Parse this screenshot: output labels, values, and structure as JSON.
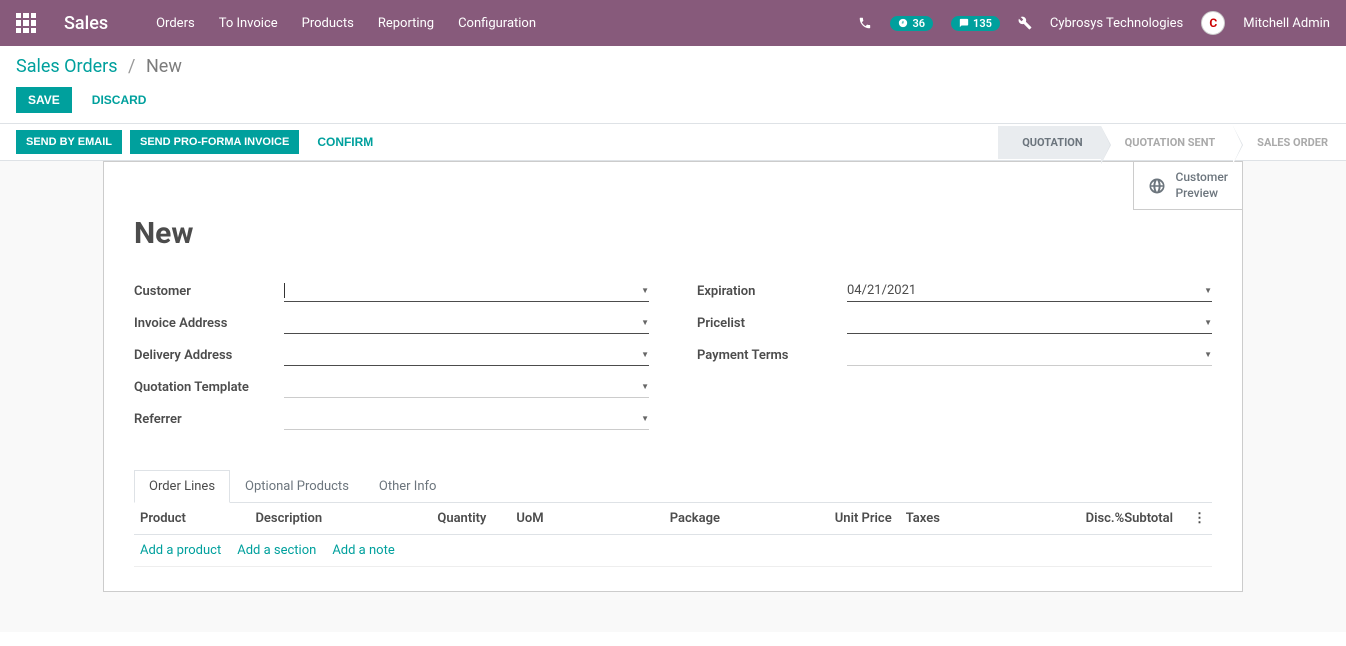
{
  "nav": {
    "brand": "Sales",
    "menu": [
      "Orders",
      "To Invoice",
      "Products",
      "Reporting",
      "Configuration"
    ],
    "badge1": "36",
    "badge2": "135",
    "company": "Cybrosys Technologies",
    "user": "Mitchell Admin",
    "avatar_initial": "C"
  },
  "breadcrumb": {
    "root": "Sales Orders",
    "current": "New"
  },
  "panel": {
    "save": "SAVE",
    "discard": "DISCARD"
  },
  "statusbar": {
    "send_email": "SEND BY EMAIL",
    "send_proforma": "SEND PRO-FORMA INVOICE",
    "confirm": "CONFIRM",
    "steps": [
      "QUOTATION",
      "QUOTATION SENT",
      "SALES ORDER"
    ]
  },
  "form": {
    "customer_preview": "Customer Preview",
    "title": "New",
    "left": {
      "customer": "Customer",
      "invoice_addr": "Invoice Address",
      "delivery_addr": "Delivery Address",
      "quote_tmpl": "Quotation Template",
      "referrer": "Referrer"
    },
    "right": {
      "expiration": "Expiration",
      "expiration_val": "04/21/2021",
      "pricelist": "Pricelist",
      "payment_terms": "Payment Terms"
    }
  },
  "notebook": {
    "tabs": [
      "Order Lines",
      "Optional Products",
      "Other Info"
    ],
    "columns": {
      "product": "Product",
      "description": "Description",
      "quantity": "Quantity",
      "uom": "UoM",
      "package": "Package",
      "unit_price": "Unit Price",
      "taxes": "Taxes",
      "disc": "Disc.%",
      "subtotal": "Subtotal",
      "more": "⋮"
    },
    "add": {
      "product": "Add a product",
      "section": "Add a section",
      "note": "Add a note"
    }
  }
}
